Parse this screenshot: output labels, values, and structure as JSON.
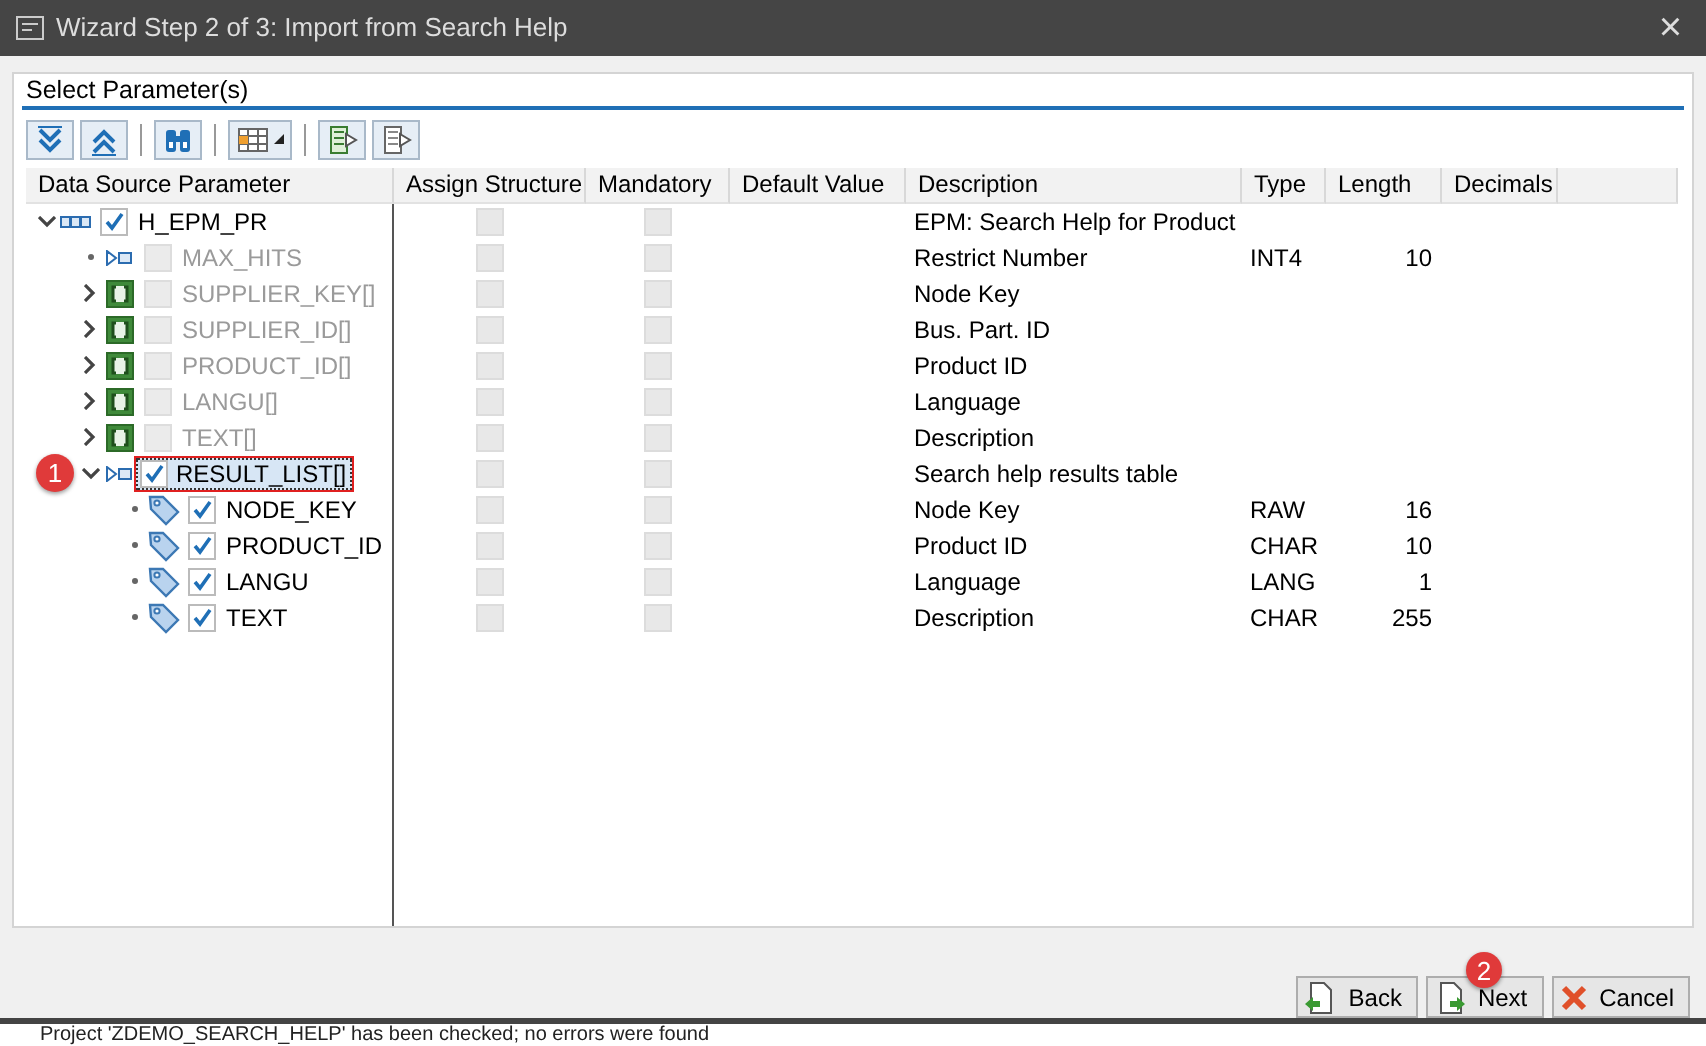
{
  "window": {
    "title": "Wizard Step 2 of 3: Import from Search Help",
    "close": "×"
  },
  "section_title": "Select Parameter(s)",
  "table": {
    "columns": [
      "Data Source Parameter",
      "Assign Structure",
      "Mandatory",
      "Default Value",
      "Description",
      "Type",
      "Length",
      "Decimals"
    ],
    "rows": [
      {
        "name": "H_EPM_PR",
        "kind": "structure",
        "checked": true,
        "disabled": false,
        "selected": false,
        "expanded": true,
        "assign_structure": false,
        "mandatory": false,
        "description": "EPM: Search Help for Product",
        "children": [
          {
            "name": "MAX_HITS",
            "kind": "parameter",
            "checked": false,
            "disabled": true,
            "selected": false,
            "assign_structure": false,
            "mandatory": false,
            "description": "Restrict Number",
            "type": "INT4",
            "length": "10"
          },
          {
            "name": "SUPPLIER_KEY[]",
            "kind": "table",
            "checked": false,
            "disabled": true,
            "selected": false,
            "expanded": false,
            "assign_structure": false,
            "mandatory": false,
            "description": "Node Key"
          },
          {
            "name": "SUPPLIER_ID[]",
            "kind": "table",
            "checked": false,
            "disabled": true,
            "selected": false,
            "expanded": false,
            "assign_structure": false,
            "mandatory": false,
            "description": "Bus. Part. ID"
          },
          {
            "name": "PRODUCT_ID[]",
            "kind": "table",
            "checked": false,
            "disabled": true,
            "selected": false,
            "expanded": false,
            "assign_structure": false,
            "mandatory": false,
            "description": "Product ID"
          },
          {
            "name": "LANGU[]",
            "kind": "table",
            "checked": false,
            "disabled": true,
            "selected": false,
            "expanded": false,
            "assign_structure": false,
            "mandatory": false,
            "description": "Language"
          },
          {
            "name": "TEXT[]",
            "kind": "table",
            "checked": false,
            "disabled": true,
            "selected": false,
            "expanded": false,
            "assign_structure": false,
            "mandatory": false,
            "description": "Description"
          },
          {
            "name": "RESULT_LIST[]",
            "kind": "parameter",
            "checked": true,
            "disabled": false,
            "selected": true,
            "expanded": true,
            "badge": "1",
            "assign_structure": false,
            "mandatory": false,
            "description": "Search help results table",
            "children": [
              {
                "name": "NODE_KEY",
                "kind": "tag",
                "checked": true,
                "disabled": false,
                "selected": false,
                "assign_structure": false,
                "mandatory": false,
                "description": "Node Key",
                "type": "RAW",
                "length": "16"
              },
              {
                "name": "PRODUCT_ID",
                "kind": "tag",
                "checked": true,
                "disabled": false,
                "selected": false,
                "assign_structure": false,
                "mandatory": false,
                "description": "Product ID",
                "type": "CHAR",
                "length": "10"
              },
              {
                "name": "LANGU",
                "kind": "tag",
                "checked": true,
                "disabled": false,
                "selected": false,
                "assign_structure": false,
                "mandatory": false,
                "description": "Language",
                "type": "LANG",
                "length": "1"
              },
              {
                "name": "TEXT",
                "kind": "tag",
                "checked": true,
                "disabled": false,
                "selected": false,
                "assign_structure": false,
                "mandatory": false,
                "description": "Description",
                "type": "CHAR",
                "length": "255"
              }
            ]
          }
        ]
      }
    ]
  },
  "buttons": [
    {
      "label": "Back",
      "kind": "back"
    },
    {
      "label": "Next",
      "kind": "next",
      "badge": "2"
    },
    {
      "label": "Cancel",
      "kind": "cancel"
    }
  ],
  "status_bar": "Project 'ZDEMO_SEARCH_HELP' has been checked; no errors were found"
}
